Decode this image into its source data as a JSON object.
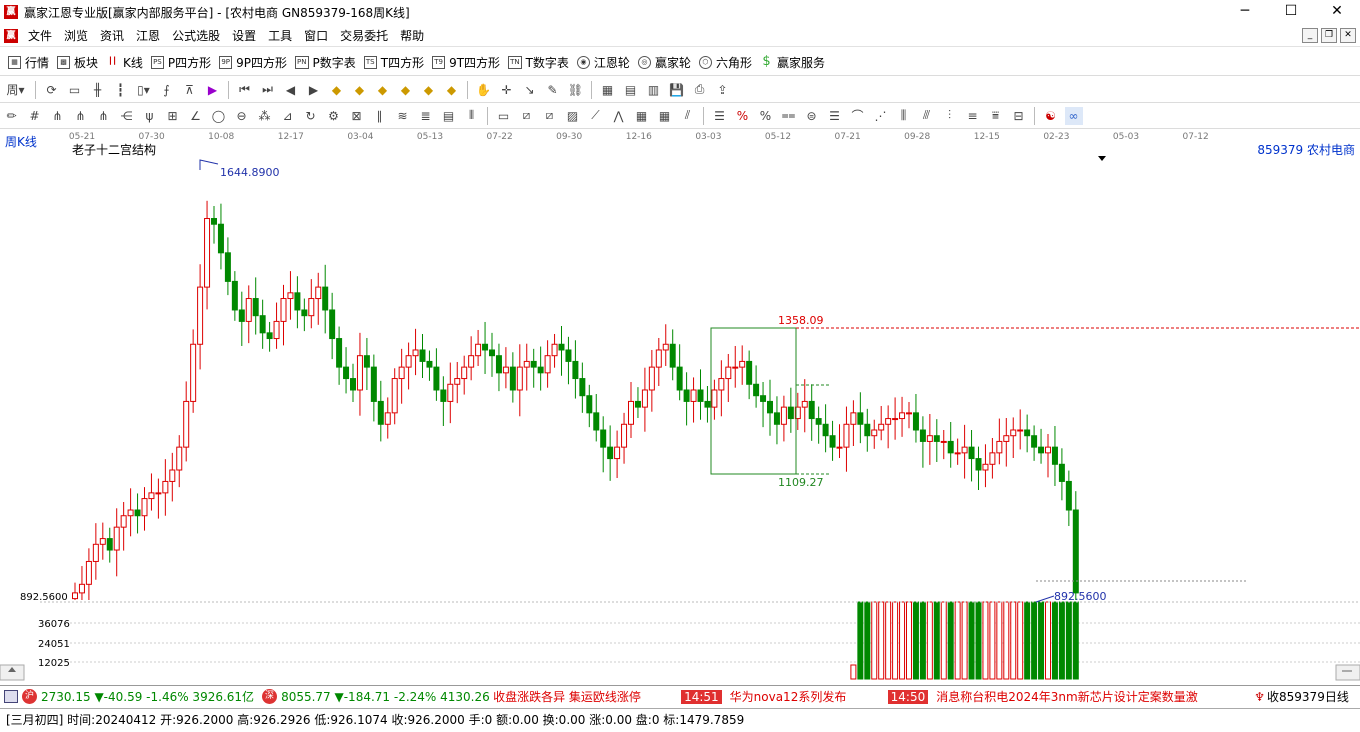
{
  "window": {
    "title": "赢家江恩专业版[赢家内部服务平台] - [农村电商  GN859379-168周K线]",
    "minimize": "─",
    "maximize": "☐",
    "close": "✕"
  },
  "menu": {
    "items": [
      "文件",
      "浏览",
      "资讯",
      "江恩",
      "公式选股",
      "设置",
      "工具",
      "窗口",
      "交易委托",
      "帮助"
    ]
  },
  "nav": {
    "items": [
      {
        "icon": "table-icon",
        "label": "行情"
      },
      {
        "icon": "blocks-icon",
        "label": "板块"
      },
      {
        "icon": "kline-icon",
        "label": "K线"
      },
      {
        "icon": "ps-icon",
        "label": "P四方形",
        "badge": "PS"
      },
      {
        "icon": "9p-icon",
        "label": "9P四方形",
        "badge": "9P"
      },
      {
        "icon": "pn-icon",
        "label": "P数字表",
        "badge": "PN"
      },
      {
        "icon": "ts-icon",
        "label": "T四方形",
        "badge": "TS"
      },
      {
        "icon": "t9-icon",
        "label": "9T四方形",
        "badge": "T9"
      },
      {
        "icon": "tn-icon",
        "label": "T数字表",
        "badge": "TN"
      },
      {
        "icon": "gann-wheel-icon",
        "label": "江恩轮"
      },
      {
        "icon": "winner-wheel-icon",
        "label": "赢家轮"
      },
      {
        "icon": "hexagon-icon",
        "label": "六角形"
      },
      {
        "icon": "dollar-icon",
        "label": "赢家服务"
      }
    ]
  },
  "chart_header": {
    "period_label": "周K线",
    "indicator_name": "老子十二宫结构",
    "symbol": "859379  农村电商"
  },
  "chart_data": {
    "type": "candlestick",
    "x_tick_labels": [
      "05-21",
      "07-30",
      "10-08",
      "12-17",
      "03-04",
      "05-13",
      "07-22",
      "09-30",
      "12-16",
      "03-03",
      "05-12",
      "07-21",
      "09-28",
      "12-15",
      "02-23",
      "05-03",
      "07-12"
    ],
    "annotations": {
      "high": "1644.8900",
      "box_top": "1358.09",
      "box_bottom": "1109.27",
      "low": "892.5600"
    },
    "price_axis_label": "892.5600",
    "volume_ticks": [
      "36076",
      "24051",
      "12025"
    ],
    "ylim": [
      892.56,
      1644.89
    ],
    "candles_close": [
      905,
      920,
      960,
      990,
      1000,
      980,
      1020,
      1040,
      1050,
      1040,
      1070,
      1080,
      1080,
      1100,
      1120,
      1160,
      1240,
      1340,
      1440,
      1560,
      1550,
      1500,
      1450,
      1400,
      1380,
      1420,
      1390,
      1360,
      1350,
      1380,
      1420,
      1430,
      1400,
      1390,
      1420,
      1440,
      1400,
      1350,
      1300,
      1280,
      1260,
      1320,
      1300,
      1240,
      1200,
      1220,
      1280,
      1300,
      1320,
      1330,
      1310,
      1300,
      1260,
      1240,
      1270,
      1280,
      1300,
      1320,
      1340,
      1330,
      1320,
      1290,
      1300,
      1260,
      1300,
      1310,
      1300,
      1290,
      1320,
      1340,
      1330,
      1310,
      1280,
      1250,
      1220,
      1190,
      1160,
      1140,
      1160,
      1200,
      1240,
      1230,
      1260,
      1300,
      1330,
      1340,
      1300,
      1260,
      1240,
      1260,
      1240,
      1230,
      1260,
      1280,
      1300,
      1300,
      1310,
      1270,
      1250,
      1240,
      1220,
      1200,
      1230,
      1210,
      1230,
      1240,
      1210,
      1200,
      1180,
      1160,
      1160,
      1200,
      1220,
      1200,
      1180,
      1190,
      1200,
      1210,
      1210,
      1220,
      1220,
      1190,
      1170,
      1180,
      1170,
      1170,
      1150,
      1150,
      1160,
      1140,
      1120,
      1130,
      1150,
      1170,
      1180,
      1190,
      1190,
      1180,
      1160,
      1150,
      1160,
      1130,
      1100,
      1050,
      905
    ]
  },
  "ticker": [
    {
      "icon": "sh-index-icon",
      "badge": "沪",
      "text": "2730.15 ▼-40.59 -1.46% 3926.61亿",
      "color": "#008800"
    },
    {
      "icon": "sz-index-icon",
      "badge": "深",
      "text": "8055.77 ▼-184.71 -2.24% 4130.26",
      "color": "#008800"
    }
  ],
  "news": [
    {
      "time": "",
      "text": "收盘涨跌各异 集运欧线涨停"
    },
    {
      "time": "14:51",
      "text": "华为nova12系列发布"
    },
    {
      "time": "14:50",
      "text": "消息称台积电2024年3nm新芯片设计定案数量激"
    }
  ],
  "ticker_right": "收859379日线",
  "status": "[三月初四] 时间:20240412 开:926.2000 高:926.2926 低:926.1074 收:926.2000 手:0 额:0.00 换:0.00 涨:0.00 盘:0 标:1479.7859",
  "colors": {
    "up": "#dd0000",
    "down": "#008800",
    "grid": "#c0c0c0"
  }
}
